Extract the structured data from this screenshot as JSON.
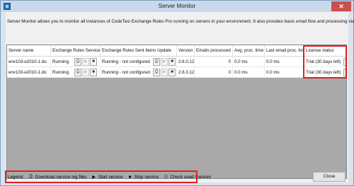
{
  "window": {
    "title": "Server Monitor"
  },
  "intro": "Server Monitor allows you to monitor all instances of CodeTwo Exchange Rules Pro running on servers in your environment. It also provides basic email flow and processing statistics.",
  "columns": [
    "Server name",
    "Exchange Rules Service",
    "Exchange Rules Sent Items Update",
    "Version",
    "Emails processed",
    "Avg. proc. time",
    "Last email proc. time",
    "License status"
  ],
  "rows": [
    {
      "server": "env103-e2010-1.do",
      "service_status": "Running",
      "sent_items_status": "Running - not configured",
      "version": "2.6.0.124",
      "emails_processed": "0",
      "avg_proc_time": "0.0 ms",
      "last_proc_time": "0.0 ms",
      "license": "Trial (30 days left)"
    },
    {
      "server": "env103-e2010-1.do",
      "service_status": "Running",
      "sent_items_status": "Running - not configured",
      "version": "2.6.0.124",
      "emails_processed": "0",
      "avg_proc_time": "0.0 ms",
      "last_proc_time": "0.0 ms",
      "license": "Trial (30 days left)"
    }
  ],
  "icons": {
    "log": "log-file-icon",
    "start": "play-icon",
    "stop": "stop-icon",
    "licenses": "license-list-icon"
  },
  "legend": {
    "label": "Legend:",
    "download": "Download service log files",
    "start": "Start service",
    "stop": "Stop service",
    "check": "Check used licenses"
  },
  "buttons": {
    "close": "Close"
  },
  "colors": {
    "highlight": "#e02020",
    "titlebar": "#c9d8ea",
    "grid_bg": "#a9a9a9"
  }
}
